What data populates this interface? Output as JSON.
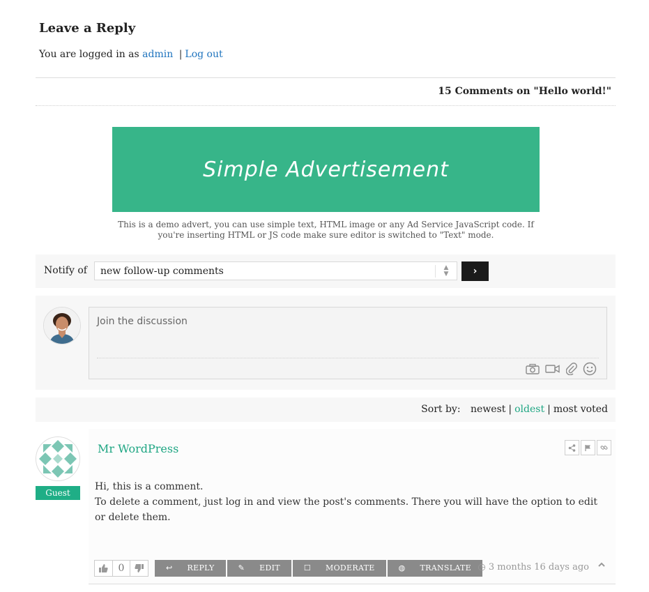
{
  "reply": {
    "title": "Leave a Reply",
    "logged_prefix": "You are logged in as",
    "user": "admin",
    "separator": "|",
    "logout": "Log out"
  },
  "comments_heading": "15 Comments on \"Hello world!\"",
  "advert": {
    "banner_text": "Simple Advertisement",
    "banner_color": "#37b589",
    "note": "This is a demo advert, you can use simple text, HTML image or any Ad Service JavaScript code. If you're inserting HTML or JS code make sure editor is switched to \"Text\" mode."
  },
  "notify": {
    "label": "Notify of",
    "selected": "new follow-up comments",
    "submit": "›"
  },
  "editor": {
    "placeholder": "Join the discussion",
    "tools": [
      "camera-icon",
      "video-icon",
      "attachment-icon",
      "smiley-icon"
    ]
  },
  "sort": {
    "label": "Sort by:",
    "options": [
      "newest",
      "oldest",
      "most voted"
    ],
    "active": "oldest",
    "sep": "|"
  },
  "comment": {
    "author": "Mr WordPress",
    "badge": "Guest",
    "line1": "Hi, this is a comment.",
    "line2": "To delete a comment, just log in and view the post's comments. There you will have the option to edit or delete them.",
    "votes": "0",
    "actions": {
      "reply": "REPLY",
      "edit": "EDIT",
      "moderate": "MODERATE",
      "translate": "TRANSLATE"
    },
    "time": "3 months 16 days ago",
    "accent": "#1fa683"
  }
}
